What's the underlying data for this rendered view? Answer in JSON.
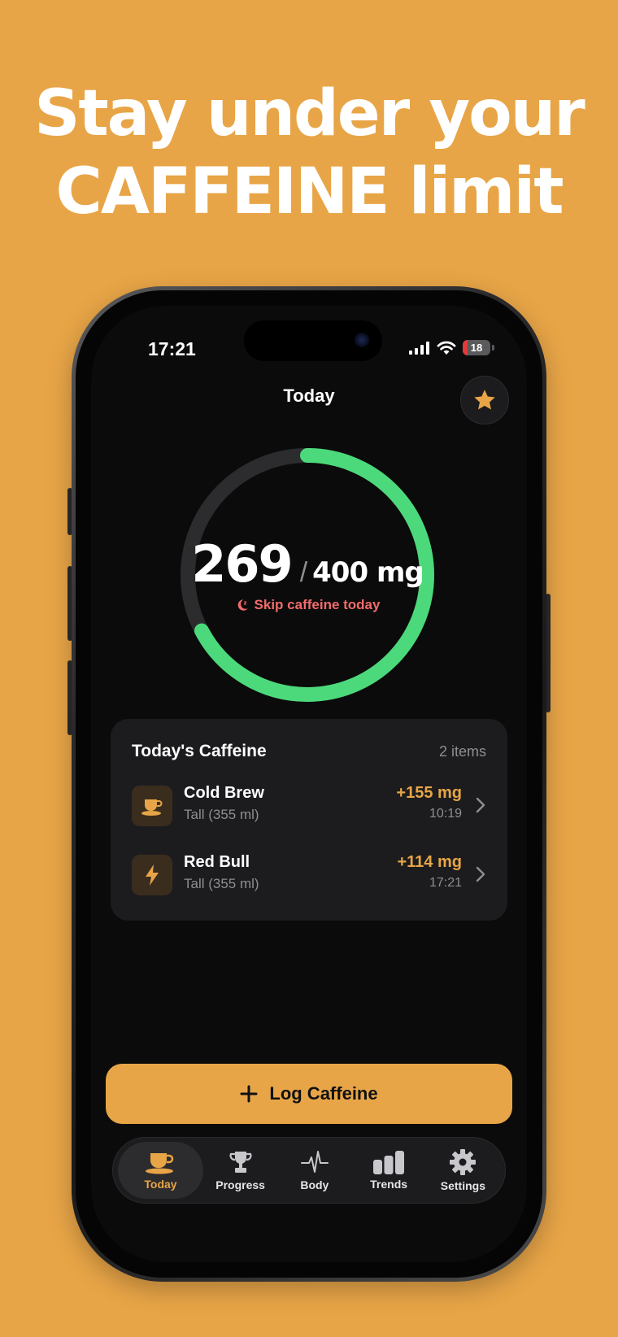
{
  "headline": {
    "line1": "Stay under your",
    "line2": "CAFFEINE limit"
  },
  "status_bar": {
    "time": "17:21",
    "battery": "18"
  },
  "screen": {
    "title": "Today",
    "star_icon": "star-icon"
  },
  "ring": {
    "consumed": "269",
    "separator": "/",
    "limit": "400 mg",
    "consumed_mg": 269,
    "limit_mg": 400,
    "skip_text": "Skip caffeine today",
    "track_color": "#2c2c2e",
    "progress_color": "#4CD97B"
  },
  "caffeine_list": {
    "title": "Today's Caffeine",
    "count": "2 items",
    "items": [
      {
        "name": "Cold Brew",
        "size": "Tall (355 ml)",
        "amount": "+155 mg",
        "time": "10:19",
        "icon": "coffee-cup-icon"
      },
      {
        "name": "Red Bull",
        "size": "Tall (355 ml)",
        "amount": "+114 mg",
        "time": "17:21",
        "icon": "lightning-bolt-icon"
      }
    ]
  },
  "log_button": {
    "label": "Log Caffeine"
  },
  "tabs": [
    {
      "label": "Today",
      "icon": "coffee-cup-icon",
      "active": true
    },
    {
      "label": "Progress",
      "icon": "trophy-icon",
      "active": false
    },
    {
      "label": "Body",
      "icon": "pulse-icon",
      "active": false
    },
    {
      "label": "Trends",
      "icon": "bar-chart-icon",
      "active": false
    },
    {
      "label": "Settings",
      "icon": "gear-icon",
      "active": false
    }
  ],
  "colors": {
    "background": "#E8A547",
    "accent": "#E8A547",
    "ring": "#4CD97B",
    "warning": "#F26B6B"
  }
}
